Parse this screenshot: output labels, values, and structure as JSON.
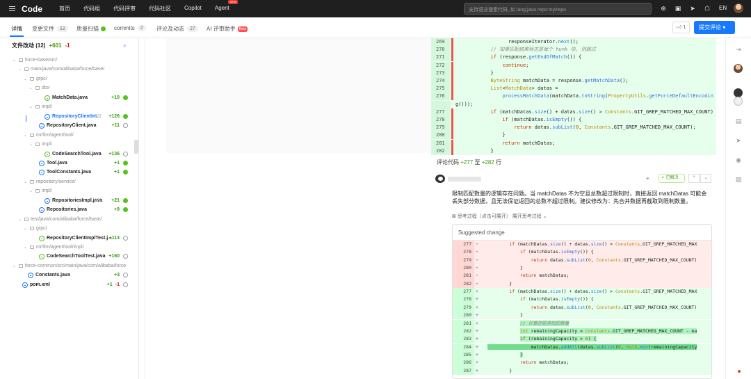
{
  "topnav": {
    "logo": "Code",
    "items": [
      "首页",
      "代码组",
      "代码评审",
      "代码社区",
      "Copilot",
      "Agent"
    ],
    "new_badge": "NEW",
    "search_placeholder": "支持语法搜索代码, 如 lang:java repo:my/repo",
    "lang": "EN"
  },
  "tabs": {
    "items": [
      {
        "label": "详情"
      },
      {
        "label": "变更文件",
        "count": "12"
      },
      {
        "label": "质量扫描"
      },
      {
        "label": "commits",
        "count": "2"
      },
      {
        "label": "评论及动态",
        "count": "27"
      },
      {
        "label": "AI 评审助手",
        "badge": "Beta"
      }
    ],
    "like_count": "1",
    "submit_label": "提交评论"
  },
  "tree": {
    "title": "文件改动 (12)",
    "added": "+601",
    "removed": "-1",
    "rows": [
      {
        "kind": "dir",
        "depth": 0,
        "label": "force-base/src/"
      },
      {
        "kind": "dir",
        "depth": 1,
        "label": "main/java/com/alibaba/force/base/"
      },
      {
        "kind": "dir",
        "depth": 2,
        "label": "grpc/"
      },
      {
        "kind": "dir",
        "depth": 3,
        "label": "dto/"
      },
      {
        "kind": "file",
        "depth": 4,
        "label": "MatchData.java",
        "diff": "+10",
        "status": "ok",
        "new": true
      },
      {
        "kind": "dir",
        "depth": 3,
        "label": "impl/"
      },
      {
        "kind": "file",
        "depth": 4,
        "label": "RepositoryClientIm...",
        "ratio": "7/7",
        "diff": "+126",
        "status": "ok",
        "selected": true
      },
      {
        "kind": "file",
        "depth": 3,
        "label": "RepositoryClient.java",
        "diff": "+11",
        "status": "empty"
      },
      {
        "kind": "dir",
        "depth": 2,
        "label": "mr/llm/agent/tool/"
      },
      {
        "kind": "dir",
        "depth": 3,
        "label": "impl/"
      },
      {
        "kind": "file",
        "depth": 4,
        "label": "CodeSearchTool.java",
        "diff": "+136",
        "status": "empty",
        "new": true
      },
      {
        "kind": "file",
        "depth": 3,
        "label": "Tool.java",
        "diff": "+1",
        "status": "ok"
      },
      {
        "kind": "file",
        "depth": 3,
        "label": "ToolConstants.java",
        "diff": "+1",
        "status": "ok"
      },
      {
        "kind": "dir",
        "depth": 2,
        "label": "repository/service/"
      },
      {
        "kind": "dir",
        "depth": 3,
        "label": "impl/"
      },
      {
        "kind": "file",
        "depth": 4,
        "label": "RepositoriesImpl.java",
        "ratio": "1/1",
        "diff": "+21",
        "status": "ok"
      },
      {
        "kind": "file",
        "depth": 3,
        "label": "Repositories.java",
        "diff": "+9",
        "status": "ok"
      },
      {
        "kind": "dir",
        "depth": 1,
        "label": "test/java/com/alibaba/force/base/"
      },
      {
        "kind": "dir",
        "depth": 2,
        "label": "grpc/"
      },
      {
        "kind": "file",
        "depth": 3,
        "label": "RepositoryClientImplTest.j...",
        "diff": "+113",
        "status": "empty",
        "new": true
      },
      {
        "kind": "dir",
        "depth": 2,
        "label": "mr/llm/agent/tool/impl/"
      },
      {
        "kind": "file",
        "depth": 3,
        "label": "CodeSearchToolTest.java",
        "diff": "+160",
        "status": "empty",
        "new": true
      },
      {
        "kind": "dir",
        "depth": 0,
        "label": "force-common/src/main/java/com/alibaba/force"
      },
      {
        "kind": "file",
        "depth": 1,
        "label": "Constants.java",
        "diff": "+3",
        "status": "empty"
      },
      {
        "kind": "file",
        "depth": 0,
        "label": "pom.xml",
        "diff": "+1",
        "del": "-1",
        "status": "empty"
      }
    ]
  },
  "code": {
    "lines": [
      {
        "n": "269",
        "mark": true,
        "html": "                  responseIterator.<span class='fn'>next</span>();"
      },
      {
        "n": "270",
        "mark": true,
        "html": "            <span class='cm'>// 如果匹配结果标志是每个 hunk 块, 则跳过</span>"
      },
      {
        "n": "271",
        "mark": true,
        "html": "            <span class='kw'>if</span> (response.<span class='fn'>getEndOfMatch</span>()) {"
      },
      {
        "n": "272",
        "mark": true,
        "html": "                <span class='kw'>continue</span>;"
      },
      {
        "n": "273",
        "mark": true,
        "html": "            }"
      },
      {
        "n": "274",
        "mark": true,
        "html": "            <span class='ty'>ByteString</span> matchData = response.<span class='fn'>getMatchData</span>();"
      },
      {
        "n": "275",
        "mark": true,
        "html": "            <span class='ty'>List</span>&lt;<span class='ty'>MatchData</span>&gt; datas ="
      },
      {
        "n": "276",
        "mark": true,
        "html": "                <span class='fn'>processMatchData</span>(matchData.<span class='fn'>toString</span>(<span class='ty'>PropertyUtils</span>.<span class='fn'>getForceDefaultEncodin</span>"
      },
      {
        "n": "",
        "mark": false,
        "html": "g()));"
      },
      {
        "n": "277",
        "mark": true,
        "html": "            <span class='kw'>if</span> (matchDatas.<span class='fn'>size</span>() + datas.<span class='fn'>size</span>() &gt; <span class='ty'>Constants</span>.GIT_GREP_MATCHED_MAX_COUNT) {"
      },
      {
        "n": "278",
        "mark": true,
        "html": "                <span class='kw'>if</span> (matchDatas.<span class='fn'>isEmpty</span>()) {"
      },
      {
        "n": "279",
        "mark": true,
        "html": "                    <span class='kw'>return</span> datas.<span class='fn'>subList</span>(<span class='cn'>0</span>, <span class='ty'>Constants</span>.GIT_GREP_MATCHED_MAX_COUNT);"
      },
      {
        "n": "280",
        "mark": true,
        "html": "                }"
      },
      {
        "n": "281",
        "mark": true,
        "html": "                <span class='kw'>return</span> matchDatas;"
      },
      {
        "n": "282",
        "mark": true,
        "html": "            }"
      }
    ]
  },
  "comment": {
    "range_prefix": "评论代码",
    "range_from": "+277",
    "range_to_word": "至",
    "range_to": "+282",
    "range_suffix": "行",
    "resolved_label": "已解决",
    "body": "限制匹配数量的逻辑存在问题。当 matchDatas 不为空且总数超过限制时，直接返回 matchDatas 可能会丢失部分数据，且无法保证返回的总数不超过限制。建议修改为：先合并数据再截取到限制数量。",
    "think_label": "⊠ 思考过程（点击可展开）",
    "expand_label": "展开思考过程",
    "suggest_title": "Suggested change",
    "suggest_lines": [
      {
        "type": "del",
        "n": "277",
        "html": "        <span class='kw'>if</span> (matchDatas.<span class='fn'>size</span>() + datas.<span class='fn'>size</span>() &gt; <span class='ty'>Constants</span>.GIT_GREP_MATCHED_MAX"
      },
      {
        "type": "del",
        "n": "278",
        "html": "            <span class='kw'>if</span> (matchDatas.<span class='fn'>isEmpty</span>()) {"
      },
      {
        "type": "del",
        "n": "279",
        "html": "                <span class='kw'>return</span> datas.<span class='fn'>subList</span>(<span class='cn'>0</span>, <span class='ty'>Constants</span>.GIT_GREP_MATCHED_MAX_COUNT)"
      },
      {
        "type": "del",
        "n": "280",
        "html": "            }"
      },
      {
        "type": "del",
        "n": "281",
        "html": "            <span class='kw'>return</span> matchDatas;"
      },
      {
        "type": "del",
        "n": "282",
        "html": "        }"
      },
      {
        "type": "add",
        "n": "277",
        "html": "        <span class='kw'>if</span> (matchDatas.<span class='fn'>size</span>() + datas.<span class='fn'>size</span>() &gt; <span class='ty'>Constants</span>.GIT_GREP_MATCHED_MAX"
      },
      {
        "type": "add",
        "n": "278",
        "html": "            <span class='kw'>if</span> (matchDatas.<span class='fn'>isEmpty</span>()) {"
      },
      {
        "type": "add",
        "n": "279",
        "html": "                <span class='kw'>return</span> datas.<span class='fn'>subList</span>(<span class='cn'>0</span>, <span class='ty'>Constants</span>.GIT_GREP_MATCHED_MAX_COUNT)"
      },
      {
        "type": "add",
        "n": "280",
        "html": "            }"
      },
      {
        "type": "add",
        "n": "281",
        "html": "            <span class='hl'><span class='cm'>// 计算还能添加的数量</span></span>"
      },
      {
        "type": "add",
        "n": "282",
        "html": "            <span class='hl'><span class='ty'>int</span> remainingCapacity = <span class='ty'>Constants</span>.GIT_GREP_MATCHED_MAX_COUNT - ma</span>"
      },
      {
        "type": "add",
        "n": "283",
        "html": "            <span class='hl'><span class='kw'>if</span> (remainingCapacity &gt; <span class='cn'>0</span>) {</span>"
      },
      {
        "type": "add",
        "n": "284",
        "html": "<span class='hl2'>                matchDatas.<span class='fn'>addAll</span>(datas.<span class='fn'>subList</span>(<span class='cn'>0</span>, <span class='ty'>Math</span>.<span class='fn'>min</span>(remainingCapacity</span>"
      },
      {
        "type": "add",
        "n": "285",
        "html": "            <span class='hl'>}</span>"
      },
      {
        "type": "add",
        "n": "286",
        "html": "            <span class='kw'>return</span> matchDatas;"
      },
      {
        "type": "add",
        "n": "287",
        "html": "        }"
      }
    ]
  }
}
